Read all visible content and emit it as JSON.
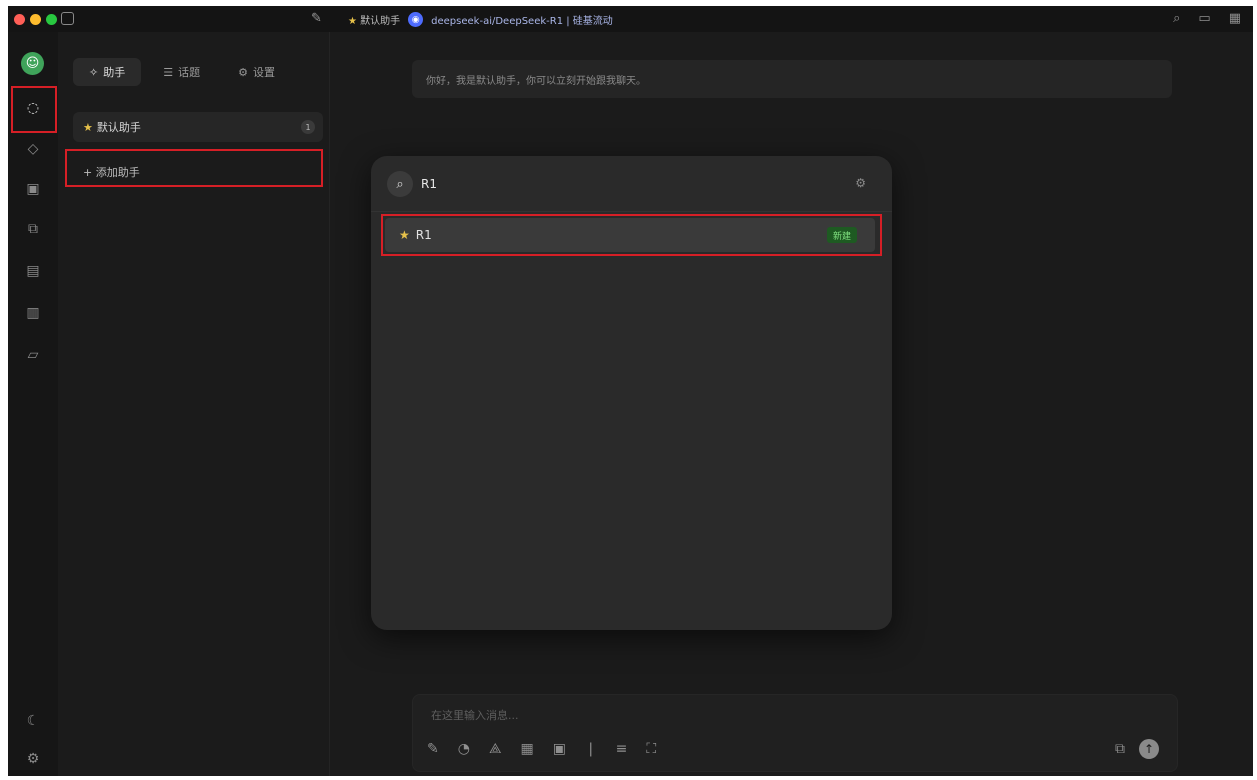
{
  "titlebar": {
    "assistant_crumb": "默认助手",
    "model_name": "deepseek-ai/DeepSeek-R1 | 硅基流动"
  },
  "panel": {
    "tabs": [
      {
        "label": "助手",
        "icon": "assistant-icon"
      },
      {
        "label": "话题",
        "icon": "topic-icon"
      },
      {
        "label": "设置",
        "icon": "settings-icon"
      }
    ],
    "assistant": {
      "label": "默认助手",
      "badge": "1"
    },
    "add_label": "+ 添加助手"
  },
  "main": {
    "notice": "你好，我是默认助手，你可以立刻开始跟我聊天。",
    "composer_placeholder": "在这里输入消息..."
  },
  "popup": {
    "search_value": "R1",
    "results": [
      {
        "label": "R1",
        "badge": "新建"
      }
    ]
  },
  "colors": {
    "window_bg": "#1b1b1b",
    "highlight": "#d61f26",
    "accent_green": "#3fa35a",
    "star": "#e6c14a"
  }
}
